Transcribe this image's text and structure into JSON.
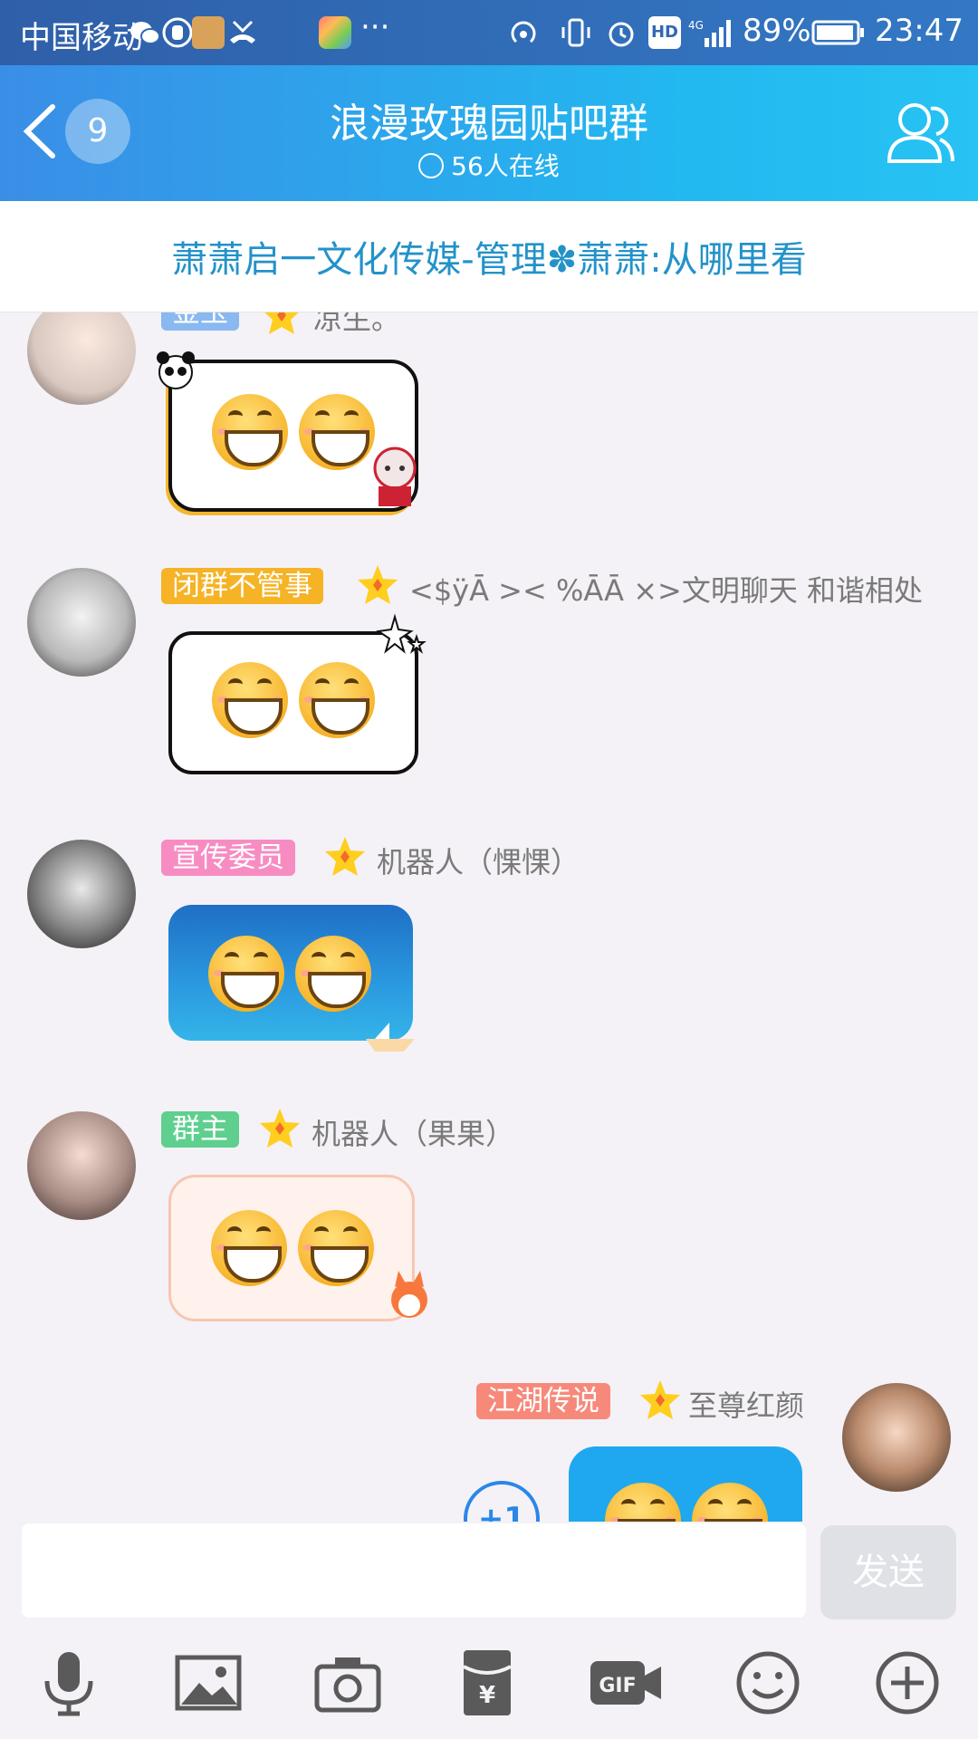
{
  "status_bar": {
    "carrier": "中国移动",
    "more": "···",
    "battery": "89%",
    "time": "23:47"
  },
  "header": {
    "unread_count": "9",
    "title": "浪漫玫瑰园贴吧群",
    "online": "56人在线"
  },
  "notice": "萧萧启一文化传媒-管理✽萧萧:从哪里看",
  "messages": [
    {
      "tag": "金玉",
      "tag_color": "#8ab8f0",
      "name": "凉生。"
    },
    {
      "tag": "闭群不管事",
      "tag_color": "#f5b325",
      "name": "<$ÿĀ >< %ĀĀ ×>文明聊天 和谐相处"
    },
    {
      "tag": "宣传委员",
      "tag_color": "#f78cc2",
      "name": "机器人（惈惈）"
    },
    {
      "tag": "群主",
      "tag_color": "#5fcf8f",
      "name": "机器人（果果）"
    },
    {
      "tag": "江湖传说",
      "tag_color": "#f7897b",
      "name": "至尊红颜"
    }
  ],
  "plus_one": "+1",
  "input": {
    "placeholder": "",
    "send_label": "发送"
  },
  "toolbar": [
    "mic-icon",
    "image-icon",
    "camera-icon",
    "red-packet-icon",
    "gif-icon",
    "emoji-icon",
    "plus-icon"
  ]
}
